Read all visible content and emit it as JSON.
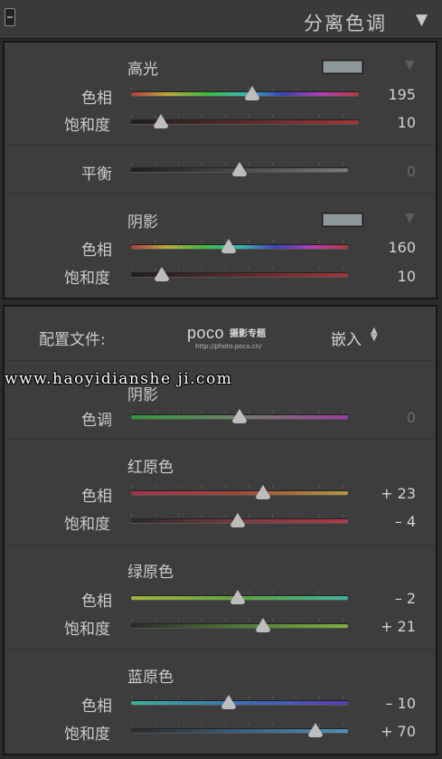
{
  "header": {
    "title": "分离色调"
  },
  "split_toning": {
    "highlight": {
      "title": "高光",
      "hue_label": "色相",
      "hue_value": "195",
      "hue_pos": 0.53,
      "sat_label": "饱和度",
      "sat_value": "10",
      "sat_pos": 0.13,
      "swatch_color": "#8e9799"
    },
    "balance": {
      "label": "平衡",
      "value": "0",
      "pos": 0.5
    },
    "shadow": {
      "title": "阴影",
      "hue_label": "色相",
      "hue_value": "160",
      "hue_pos": 0.45,
      "sat_label": "饱和度",
      "sat_value": "10",
      "sat_pos": 0.14,
      "swatch_color": "#8e9799"
    }
  },
  "camera_calibration": {
    "profile_label": "配置文件:",
    "profile_value": "嵌入",
    "logo": {
      "name": "poco",
      "tagline": "摄影专题",
      "url": "http://photo.poco.cn/"
    },
    "watermark": "www.haoyidianshe ji.com",
    "shadow": {
      "title": "阴影",
      "tone_label": "色调",
      "tone_value": "0",
      "tone_pos": 0.5
    },
    "red_primary": {
      "title": "红原色",
      "hue_label": "色相",
      "hue_value": "+ 23",
      "hue_pos": 0.61,
      "sat_label": "饱和度",
      "sat_value": "– 4",
      "sat_pos": 0.49
    },
    "green_primary": {
      "title": "绿原色",
      "hue_label": "色相",
      "hue_value": "– 2",
      "hue_pos": 0.49,
      "sat_label": "饱和度",
      "sat_value": "+ 21",
      "sat_pos": 0.61
    },
    "blue_primary": {
      "title": "蓝原色",
      "hue_label": "色相",
      "hue_value": "– 10",
      "hue_pos": 0.45,
      "sat_label": "饱和度",
      "sat_value": "+ 70",
      "sat_pos": 0.85
    }
  }
}
